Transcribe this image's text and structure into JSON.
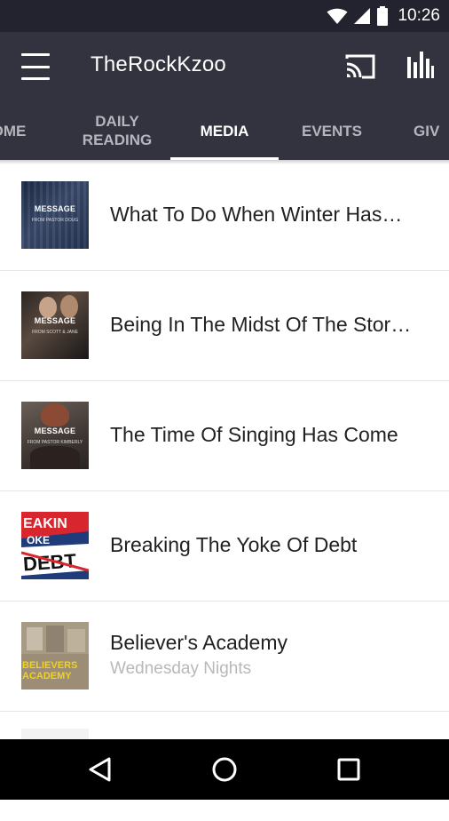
{
  "status_bar": {
    "time": "10:26",
    "icons": [
      "wifi-icon",
      "cell-signal-icon",
      "battery-icon"
    ]
  },
  "app_bar": {
    "title": "TheRockKzoo",
    "icons": [
      "menu-icon",
      "cast-icon",
      "equalizer-icon"
    ]
  },
  "tabs": [
    {
      "label": "HOME",
      "visible_text": "OME",
      "active": false
    },
    {
      "line1": "DAILY",
      "line2": "READING",
      "active": false
    },
    {
      "label": "MEDIA",
      "active": true
    },
    {
      "label": "EVENTS",
      "active": false
    },
    {
      "label": "GIVE",
      "visible_text": "GIV",
      "active": false
    }
  ],
  "media_list": [
    {
      "title": "What To Do When Winter Has…",
      "thumb_label": "MESSAGE",
      "thumb_sub": "FROM PASTOR DOUG"
    },
    {
      "title": "Being In The Midst Of The Stor…",
      "thumb_label": "MESSAGE",
      "thumb_sub": "FROM SCOTT & JANE"
    },
    {
      "title": "The Time Of Singing Has Come",
      "thumb_label": "MESSAGE",
      "thumb_sub": "FROM PASTOR KIMBERLY"
    },
    {
      "title": "Breaking The Yoke Of Debt",
      "thumb_label": "BREAKING YOKE DEBT"
    },
    {
      "title": "Believer's Academy",
      "subtitle": "Wednesday Nights",
      "thumb_label": "BELIEVERS ACADEMY"
    }
  ],
  "colors": {
    "status_bar": "#22232e",
    "app_bar": "#33333f",
    "tab_active": "#ffffff",
    "tab_inactive": "#b5b5bd",
    "title_text": "#212121",
    "subtitle_text": "#b8b8b8"
  },
  "nav_bar": {
    "icons": [
      "back-icon",
      "home-icon",
      "recents-icon"
    ]
  }
}
